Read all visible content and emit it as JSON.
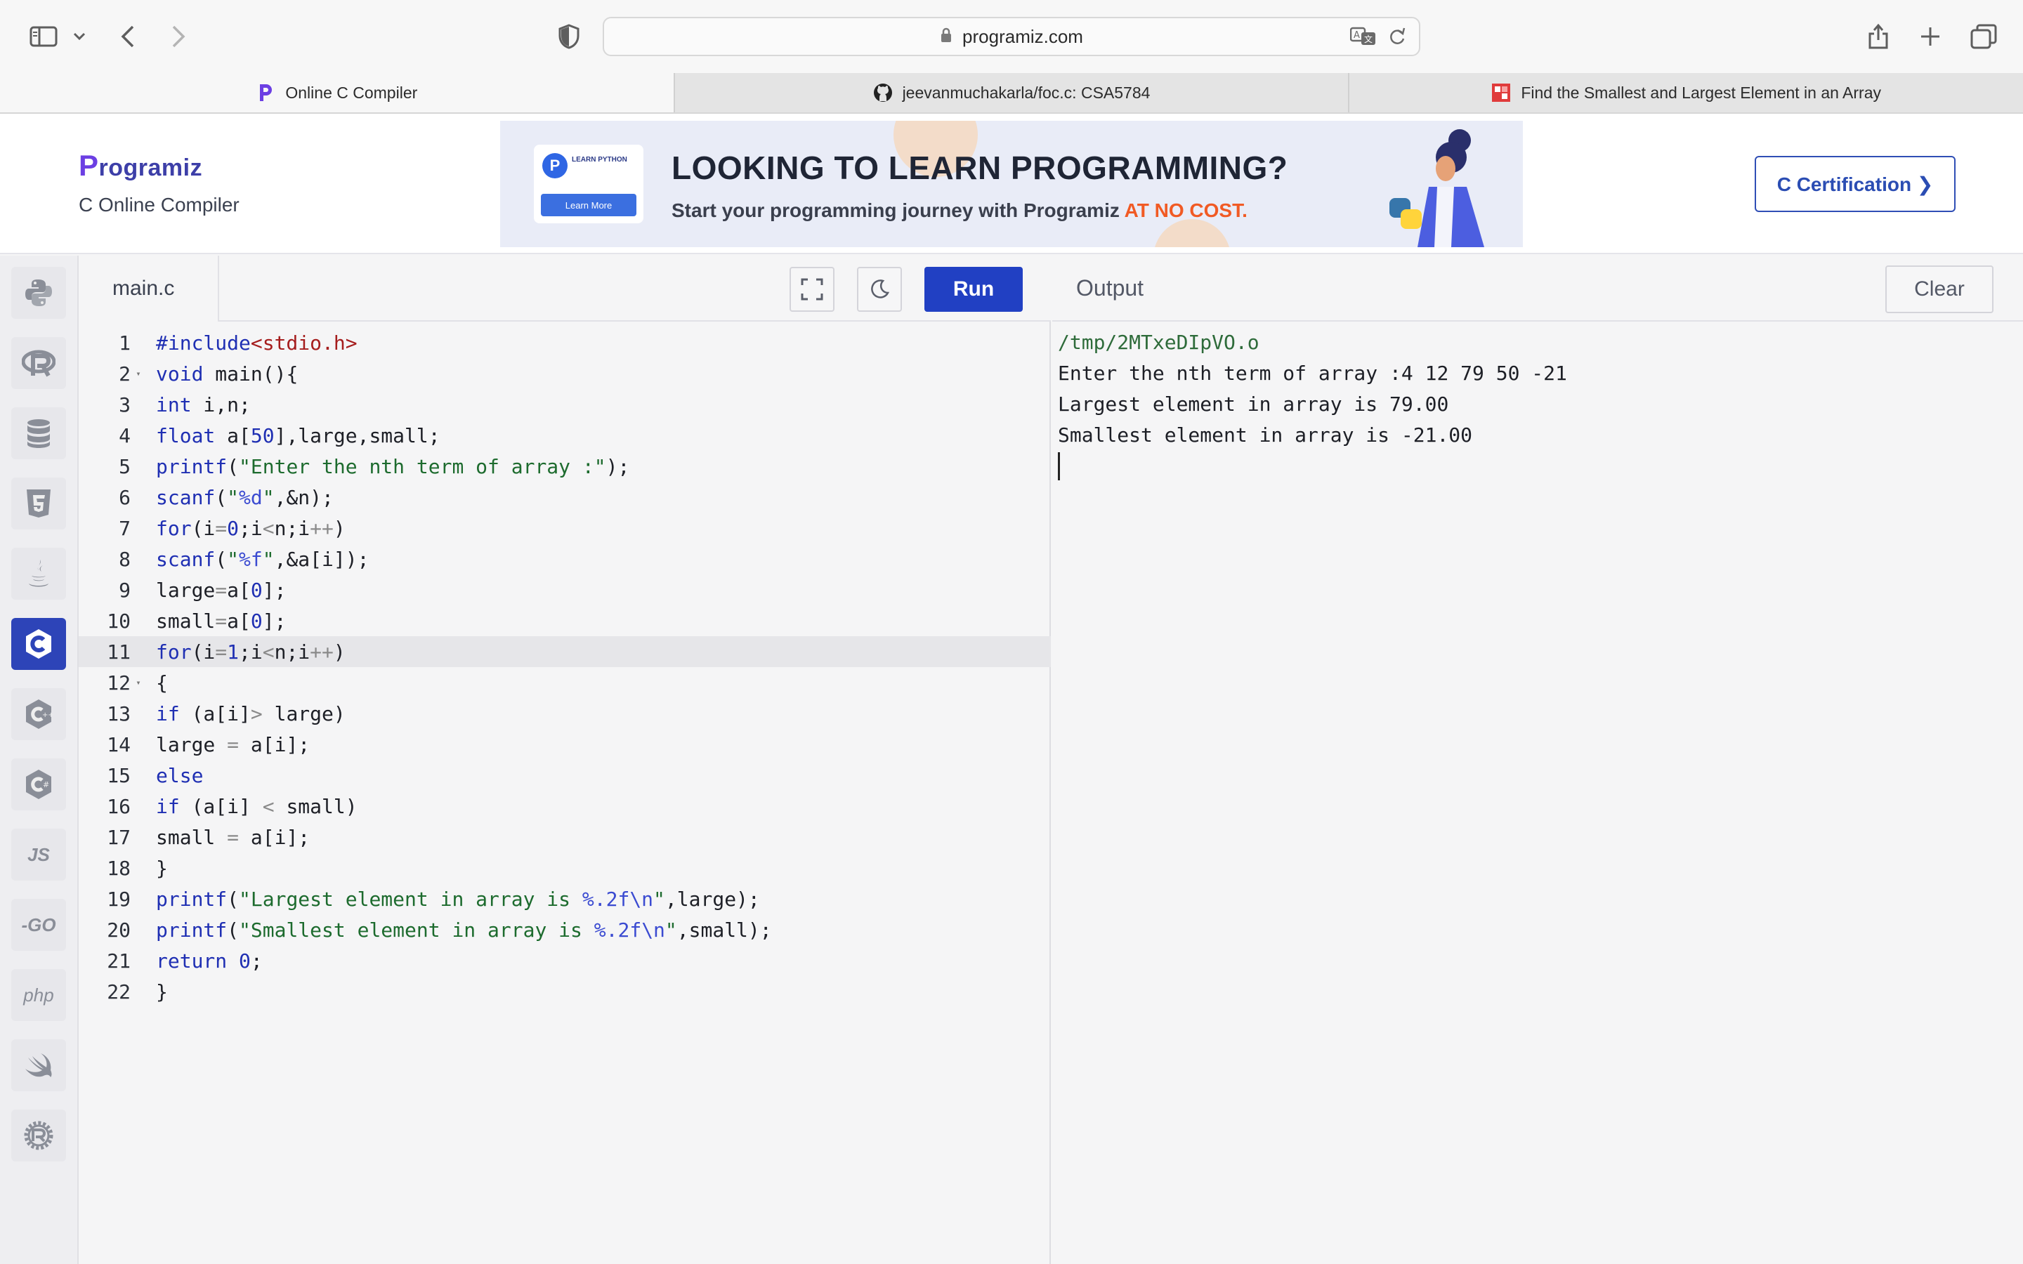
{
  "browser": {
    "url": "programiz.com",
    "tabs": [
      {
        "label": "Online C Compiler",
        "active": true
      },
      {
        "label": "jeevanmuchakarla/foc.c: CSA5784",
        "active": false
      },
      {
        "label": "Find the Smallest and Largest Element in an Array",
        "active": false
      }
    ]
  },
  "header": {
    "logo": "rogramiz",
    "logo_initial": "P",
    "subtitle": "C Online Compiler",
    "certification_button": "C Certification ❯"
  },
  "banner": {
    "card_title": "LEARN PYTHON",
    "card_button": "Learn More",
    "headline": "LOOKING TO LEARN PROGRAMMING?",
    "subline": "Start your programming journey with Programiz",
    "subline_highlight": "AT NO COST."
  },
  "sidebar": {
    "items": [
      {
        "name": "python-icon",
        "label": ""
      },
      {
        "name": "r-icon",
        "label": ""
      },
      {
        "name": "sql-icon",
        "label": ""
      },
      {
        "name": "html5-icon",
        "label": ""
      },
      {
        "name": "java-icon",
        "label": ""
      },
      {
        "name": "c-icon",
        "label": "",
        "active": true
      },
      {
        "name": "cpp-icon",
        "label": ""
      },
      {
        "name": "csharp-icon",
        "label": ""
      },
      {
        "name": "js-icon",
        "label": "JS"
      },
      {
        "name": "go-icon",
        "label": "-GO"
      },
      {
        "name": "php-icon",
        "label": "php"
      },
      {
        "name": "swift-icon",
        "label": ""
      },
      {
        "name": "rust-icon",
        "label": ""
      }
    ]
  },
  "editor": {
    "file_name": "main.c",
    "run_label": "Run",
    "highlighted_line": 11,
    "lines": [
      "#include<stdio.h>",
      "void main(){",
      "int i,n;",
      "float a[50],large,small;",
      "printf(\"Enter the nth term of array :\");",
      "scanf(\"%d\",&n);",
      "for(i=0;i<n;i++)",
      "scanf(\"%f\",&a[i]);",
      "large=a[0];",
      "small=a[0];",
      "for(i=1;i<n;i++)",
      "{",
      "if (a[i]> large)",
      "large = a[i];",
      "else",
      "if (a[i] < small)",
      "small = a[i];",
      "}",
      "printf(\"Largest element in array is %.2f\\n\",large);",
      "printf(\"Smallest element in array is %.2f\\n\",small);",
      "return 0;",
      "}"
    ],
    "fold_lines": [
      2,
      12
    ]
  },
  "output": {
    "title": "Output",
    "clear_label": "Clear",
    "lines": [
      "/tmp/2MTxeDIpVO.o",
      "Enter the nth term of array :4 12 79 50 -21",
      "Largest element in array is 79.00",
      "Smallest element in array is -21.00"
    ]
  }
}
